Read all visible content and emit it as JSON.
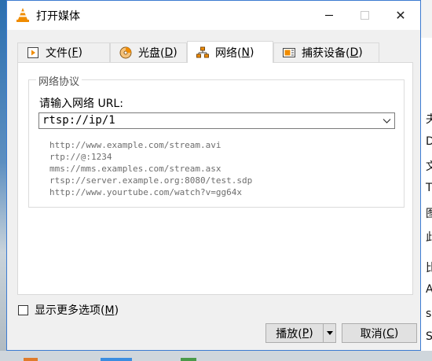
{
  "window": {
    "title": "打开媒体",
    "close_glyph": "✕"
  },
  "tabs": [
    {
      "label_pre": "文件(",
      "accel": "F",
      "label_post": ")",
      "icon": "file-play-icon",
      "active": false
    },
    {
      "label_pre": "光盘(",
      "accel": "D",
      "label_post": ")",
      "icon": "disc-icon",
      "active": false
    },
    {
      "label_pre": "网络(",
      "accel": "N",
      "label_post": ")",
      "icon": "network-icon",
      "active": true
    },
    {
      "label_pre": "捕获设备(",
      "accel": "D",
      "label_post": ")",
      "icon": "capture-device-icon",
      "active": false
    }
  ],
  "network": {
    "group_title": "网络协议",
    "url_label": "请输入网络 URL:",
    "url_value": "rtsp://ip/1",
    "examples": [
      "http://www.example.com/stream.avi",
      "rtp://@:1234",
      "mms://mms.examples.com/stream.asx",
      "rtsp://server.example.org:8080/test.sdp",
      "http://www.yourtube.com/watch?v=gg64x"
    ]
  },
  "footer": {
    "more_options_pre": "显示更多选项(",
    "more_options_accel": "M",
    "more_options_post": ")",
    "play_pre": "播放(",
    "play_accel": "P",
    "play_post": ")",
    "cancel_pre": "取消(",
    "cancel_accel": "C",
    "cancel_post": ")"
  },
  "background_window": {
    "right_fragments": [
      "夬",
      "D",
      "文",
      "T",
      "图",
      "此",
      "比",
      "A",
      "s",
      "S"
    ]
  },
  "colors": {
    "window_border": "#3c7bd1",
    "vlc_orange": "#f08c00",
    "dialog_bg": "#f0f0f0"
  }
}
